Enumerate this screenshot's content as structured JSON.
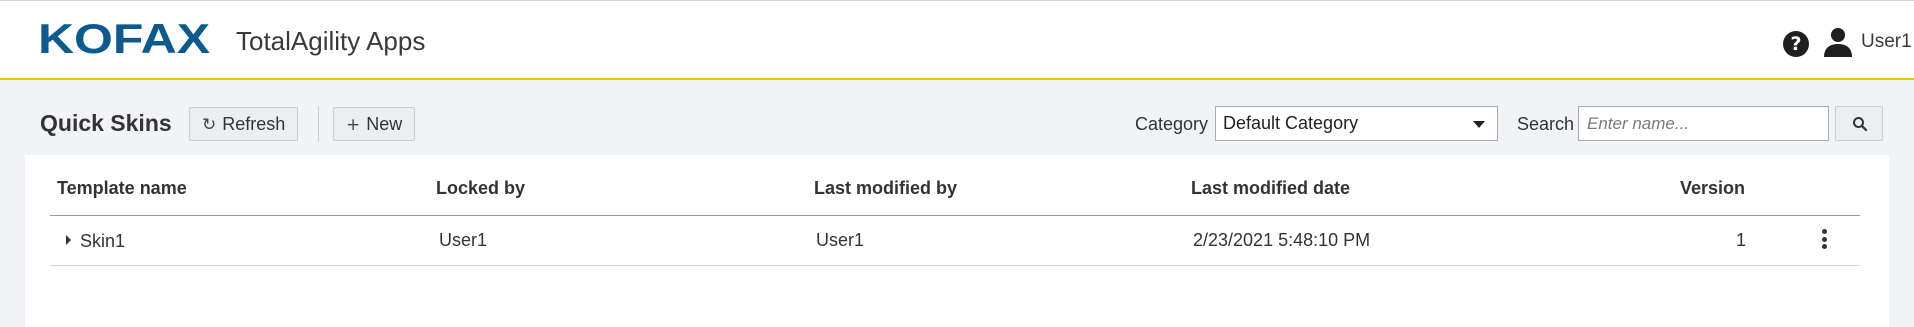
{
  "header": {
    "logo_text": "KOFAX",
    "app_title": "TotalAgility Apps",
    "help_icon": "question-circle-icon",
    "user_icon": "user-icon",
    "user_name": "User1",
    "accent_color": "#f2c200",
    "logo_color": "#0d5a8f"
  },
  "toolbar": {
    "page_title": "Quick Skins",
    "refresh_label": "Refresh",
    "refresh_icon": "↻",
    "new_label": "New",
    "new_icon": "+",
    "category_label": "Category",
    "category_value": "Default Category",
    "search_label": "Search",
    "search_placeholder": "Enter name...",
    "search_icon": "search-icon"
  },
  "table": {
    "columns": [
      "Template name",
      "Locked by",
      "Last modified by",
      "Last modified date",
      "Version"
    ],
    "rows": [
      {
        "template_name": "Skin1",
        "locked_by": "User1",
        "last_modified_by": "User1",
        "last_modified_date": "2/23/2021 5:48:10 PM",
        "version": "1"
      }
    ]
  }
}
